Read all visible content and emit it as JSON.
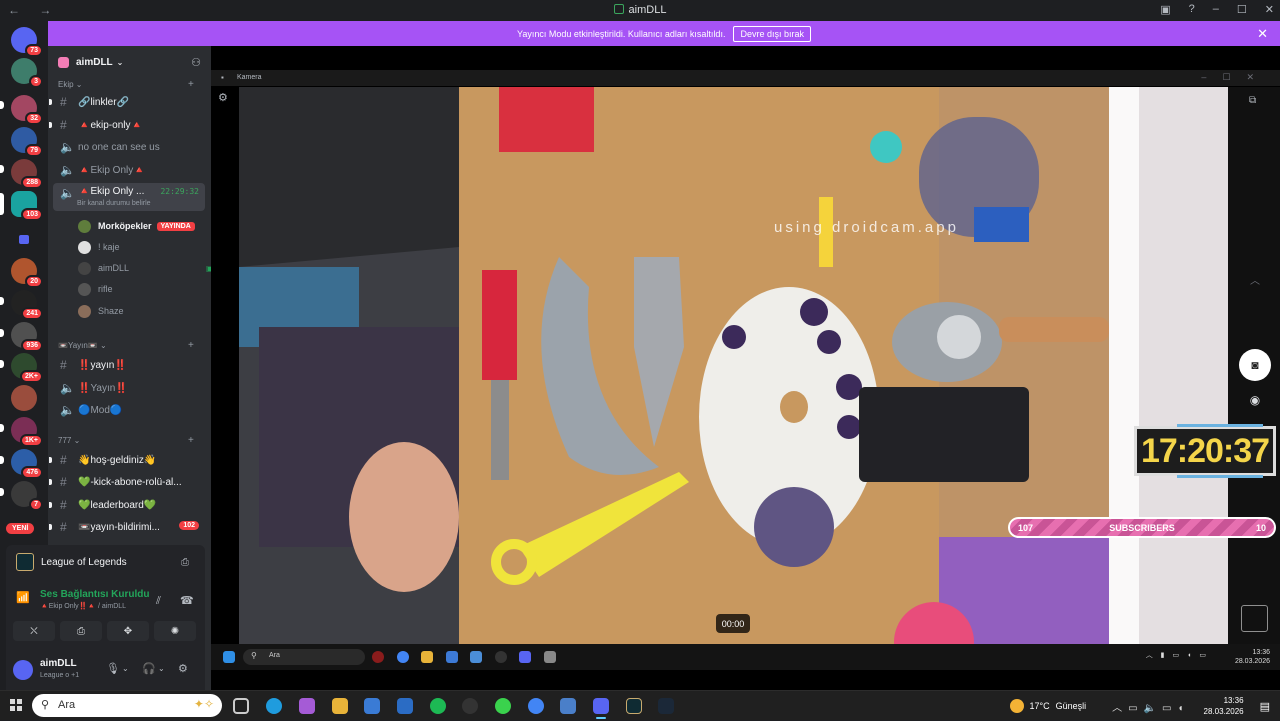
{
  "window": {
    "title": "aimDLL",
    "nav": "← →"
  },
  "banner": {
    "text": "Yayıncı Modu etkinleştirildi. Kullanıcı adları kısaltıldı.",
    "button": "Devre dışı bırak"
  },
  "guild_badges": [
    "73",
    "3",
    "32",
    "79",
    "288",
    "103",
    "20",
    "241",
    "936",
    "2K+",
    "1K+",
    "476",
    "7"
  ],
  "guild_new": "YENİ",
  "server": {
    "name": "aimDLL"
  },
  "categories": {
    "ekip": "Ekip",
    "yayin": "Yayın",
    "c777": "777"
  },
  "channels": {
    "linkler": "🔗linkler🔗",
    "ekip_only": "🔺ekip-only🔺",
    "no_one": "no one can see us",
    "ekip_only_voice": "🔺Ekip Only🔺",
    "ekip_only_active": "🔺Ekip Only ...",
    "active_time": "22:29:32",
    "active_sub": "Bir kanal durumu belirle",
    "yayin": "‼️yayın‼️",
    "yayin_voice": "‼️Yayın‼️",
    "mod": "🔵Mod🔵",
    "hos_geldiniz": "👋hoş-geldiniz👋",
    "kick": "💚-kick-abone-rolü-al...",
    "leaderboard": "💚leaderboard💚",
    "yayin_bildirim": "📼yayın-bildirimi...",
    "yayin_bildirim_count": "102"
  },
  "voice_users": [
    {
      "name": "Morköpekler",
      "live": "YAYINDA"
    },
    {
      "name": "! kaje"
    },
    {
      "name": "aimDLL"
    },
    {
      "name": "rifle"
    },
    {
      "name": "Shaze"
    }
  ],
  "voice_panel": {
    "game": "League of Legends",
    "status": "Ses Bağlantısı Kuruldu",
    "sub": "🔺Ekip Only‼️🔺 / aimDLL"
  },
  "user": {
    "name": "aimDLL",
    "status": "League o +1"
  },
  "camera": {
    "label": "Kamera",
    "watermark": "using droidcam.app",
    "time": "00:00"
  },
  "overlay": {
    "clock": "17:20:37",
    "subs_left": "107",
    "subs_label": "SUBSCRIBERS",
    "subs_right": "10"
  },
  "inner_taskbar": {
    "search": "Ara",
    "time": "13:36",
    "date": "28.03.2026"
  },
  "taskbar": {
    "search": "Ara",
    "weather_temp": "17°C",
    "weather_text": "Güneşli",
    "time": "13:36",
    "date": "28.03.2026"
  },
  "colors": {
    "accent": "#a653f5",
    "online": "#23a55a",
    "danger": "#f23f43",
    "clock": "#f4d54a"
  }
}
